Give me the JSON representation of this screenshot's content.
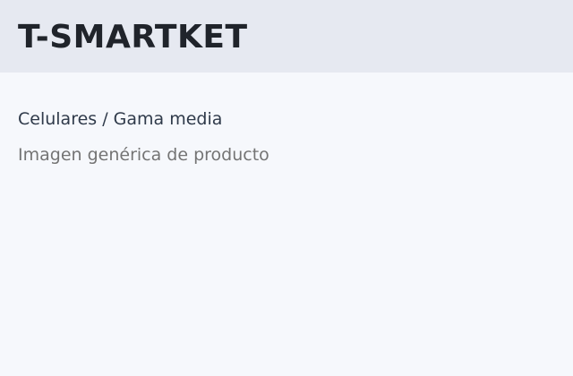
{
  "header": {
    "brand": "T-SMARTKET"
  },
  "main": {
    "breadcrumb": "Celulares / Gama media",
    "image_placeholder": "Imagen genérica de producto"
  },
  "colors": {
    "header_bg": "#e6e9f1",
    "page_bg": "#f6f8fc",
    "brand_text": "#20242b",
    "breadcrumb_text": "#2f3a4a",
    "placeholder_text": "#747474"
  }
}
